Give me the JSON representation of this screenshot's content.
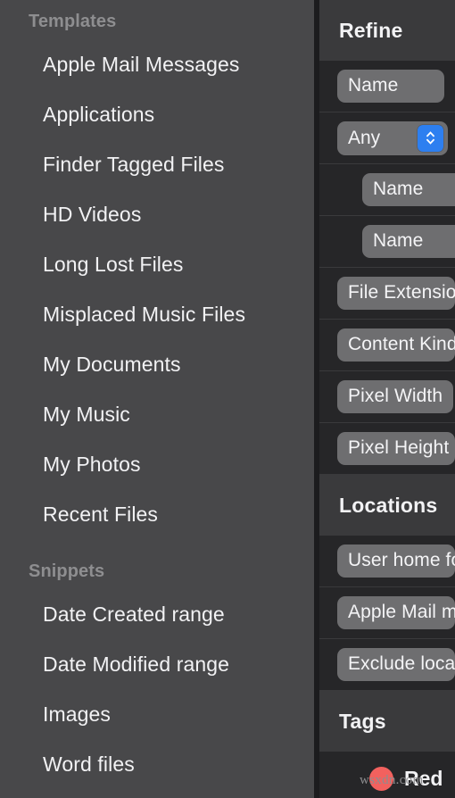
{
  "sidebar": {
    "groups": [
      {
        "header": "Templates",
        "items": [
          {
            "label": "Apple Mail Messages"
          },
          {
            "label": "Applications"
          },
          {
            "label": "Finder Tagged Files"
          },
          {
            "label": "HD Videos"
          },
          {
            "label": "Long Lost Files"
          },
          {
            "label": "Misplaced Music Files"
          },
          {
            "label": "My Documents"
          },
          {
            "label": "My Music"
          },
          {
            "label": "My Photos"
          },
          {
            "label": "Recent Files"
          }
        ]
      },
      {
        "header": "Snippets",
        "items": [
          {
            "label": "Date Created range"
          },
          {
            "label": "Date Modified range"
          },
          {
            "label": "Images"
          },
          {
            "label": "Word files"
          }
        ]
      }
    ]
  },
  "panel": {
    "sections": [
      {
        "title": "Refine",
        "rows": [
          {
            "kind": "pill",
            "label": "Name",
            "indent": false
          },
          {
            "kind": "popup",
            "label": "Any",
            "indent": false,
            "stepper_icon": "chevron-up-down-icon"
          },
          {
            "kind": "pill",
            "label": "Name",
            "indent": true
          },
          {
            "kind": "pill",
            "label": "Name",
            "indent": true
          },
          {
            "kind": "pill",
            "label": "File Extension",
            "indent": false
          },
          {
            "kind": "pill",
            "label": "Content Kind",
            "indent": false
          },
          {
            "kind": "pill",
            "label": "Pixel Width",
            "indent": false
          },
          {
            "kind": "pill",
            "label": "Pixel Height",
            "indent": false
          }
        ]
      },
      {
        "title": "Locations",
        "rows": [
          {
            "kind": "pill",
            "label": "User home folder",
            "indent": false
          },
          {
            "kind": "pill",
            "label": "Apple Mail messages",
            "indent": false
          },
          {
            "kind": "pill",
            "label": "Exclude locations",
            "indent": false
          }
        ]
      },
      {
        "title": "Tags",
        "rows": [
          {
            "kind": "tag",
            "label": "Red",
            "color": "#f2615e",
            "indent": false
          }
        ]
      }
    ]
  },
  "watermark": {
    "text": "wsxdn.com"
  },
  "colors": {
    "sidebar_bg": "#48484a",
    "panel_bg": "#262628",
    "section_header_bg": "#3a3a3c",
    "pill_bg": "#6e6e70",
    "accent_blue": "#2d7ff0",
    "tag_red": "#f2615e",
    "text_primary": "#f2f2f4",
    "text_muted": "#8e8e90"
  }
}
